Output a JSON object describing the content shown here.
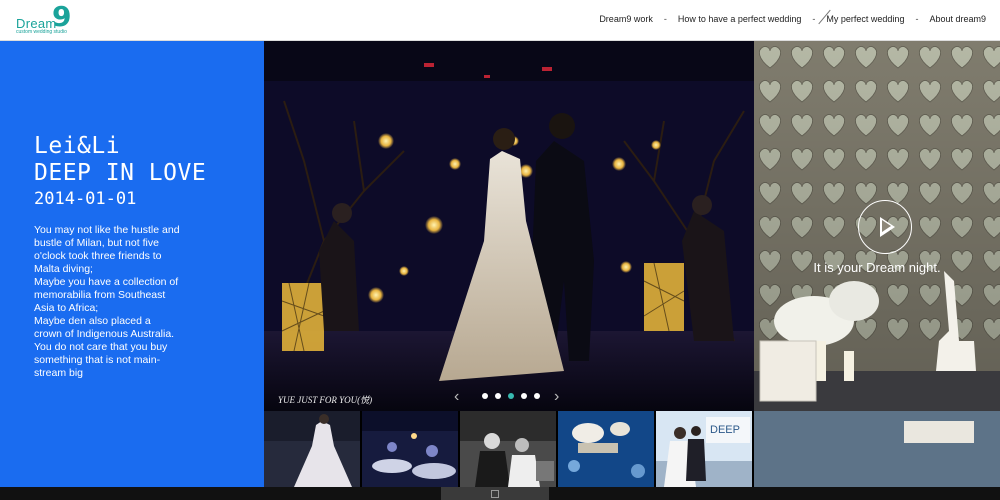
{
  "brand": {
    "name": "Dream",
    "number": "9",
    "tagline": "custom wedding studio"
  },
  "nav": {
    "items": [
      {
        "label": "Dream9 work"
      },
      {
        "label": "How to have a perfect wedding"
      },
      {
        "label": "My perfect wedding"
      },
      {
        "label": "About dream9"
      }
    ],
    "separator": "-"
  },
  "story": {
    "title_line1": "Lei&Li",
    "title_line2": "DEEP IN LOVE",
    "date": "2014-01-01",
    "description_lines": [
      "You may not like the hustle and",
      "bustle of Milan, but not five",
      "o'clock took three friends to",
      "Malta diving;",
      "Maybe you have a collection of",
      "memorabilia from Southeast",
      "Asia to Africa;",
      "Maybe den also placed a",
      "crown of Indigenous Australia.",
      "You do not care that you buy",
      "something that is not main-",
      "stream big"
    ]
  },
  "slider": {
    "caption": "YUE JUST FOR YOU(悦)",
    "prev_icon": "chevron-left-icon",
    "next_icon": "chevron-right-icon",
    "dots": 5,
    "active_dot": 2
  },
  "thumbnails": [
    {
      "label": "bride-dress"
    },
    {
      "label": "reception-hall"
    },
    {
      "label": "bw-couple"
    },
    {
      "label": "stage-flowers"
    },
    {
      "label": "deep-in-love-sign"
    }
  ],
  "video": {
    "text": "It is your Dream night.",
    "icon": "play-icon"
  },
  "colors": {
    "accent": "#1aa39a",
    "panel_blue": "#1a6cf0",
    "active_dot": "#37b9b0"
  }
}
